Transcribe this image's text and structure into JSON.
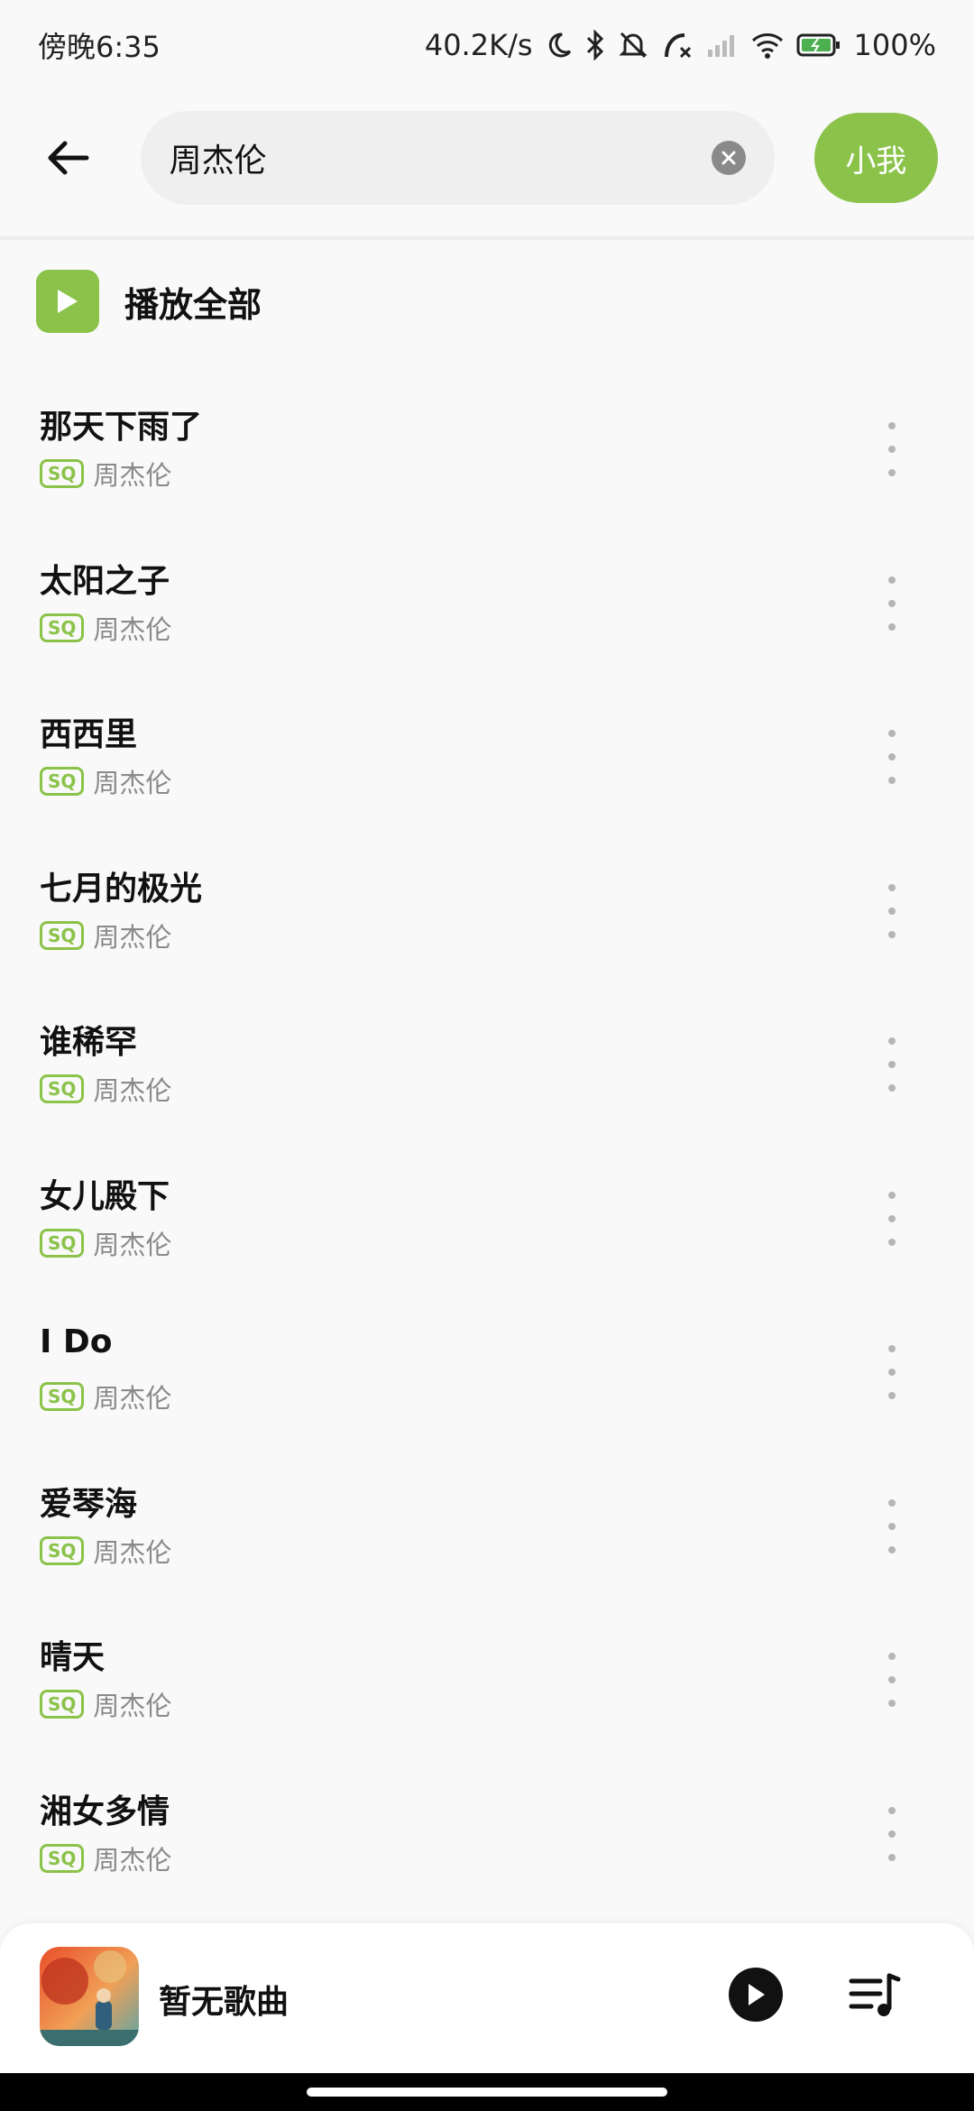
{
  "status_bar": {
    "time": "傍晚6:35",
    "net_speed": "40.2K/s",
    "battery": "100%"
  },
  "search": {
    "query": "周杰伦",
    "ai_button_label": "小我"
  },
  "play_all_label": "播放全部",
  "songs": [
    {
      "title": "那天下雨了",
      "badge": "SQ",
      "artist": "周杰伦"
    },
    {
      "title": "太阳之子",
      "badge": "SQ",
      "artist": "周杰伦"
    },
    {
      "title": "西西里",
      "badge": "SQ",
      "artist": "周杰伦"
    },
    {
      "title": "七月的极光",
      "badge": "SQ",
      "artist": "周杰伦"
    },
    {
      "title": "谁稀罕",
      "badge": "SQ",
      "artist": "周杰伦"
    },
    {
      "title": "女儿殿下",
      "badge": "SQ",
      "artist": "周杰伦"
    },
    {
      "title": "I Do",
      "badge": "SQ",
      "artist": "周杰伦"
    },
    {
      "title": "爱琴海",
      "badge": "SQ",
      "artist": "周杰伦"
    },
    {
      "title": "晴天",
      "badge": "SQ",
      "artist": "周杰伦"
    },
    {
      "title": "湘女多情",
      "badge": "SQ",
      "artist": "周杰伦"
    }
  ],
  "player": {
    "now_playing": "暂无歌曲"
  },
  "colors": {
    "accent": "#8bc34a",
    "background": "#f9f9f9",
    "secondary_text": "#8a8a8a"
  },
  "icons": {
    "back": "arrow-left-icon",
    "clear": "clear-icon",
    "play_all": "play-icon",
    "more": "more-vertical-icon",
    "player_play": "play-circle-icon",
    "queue": "playlist-icon"
  }
}
